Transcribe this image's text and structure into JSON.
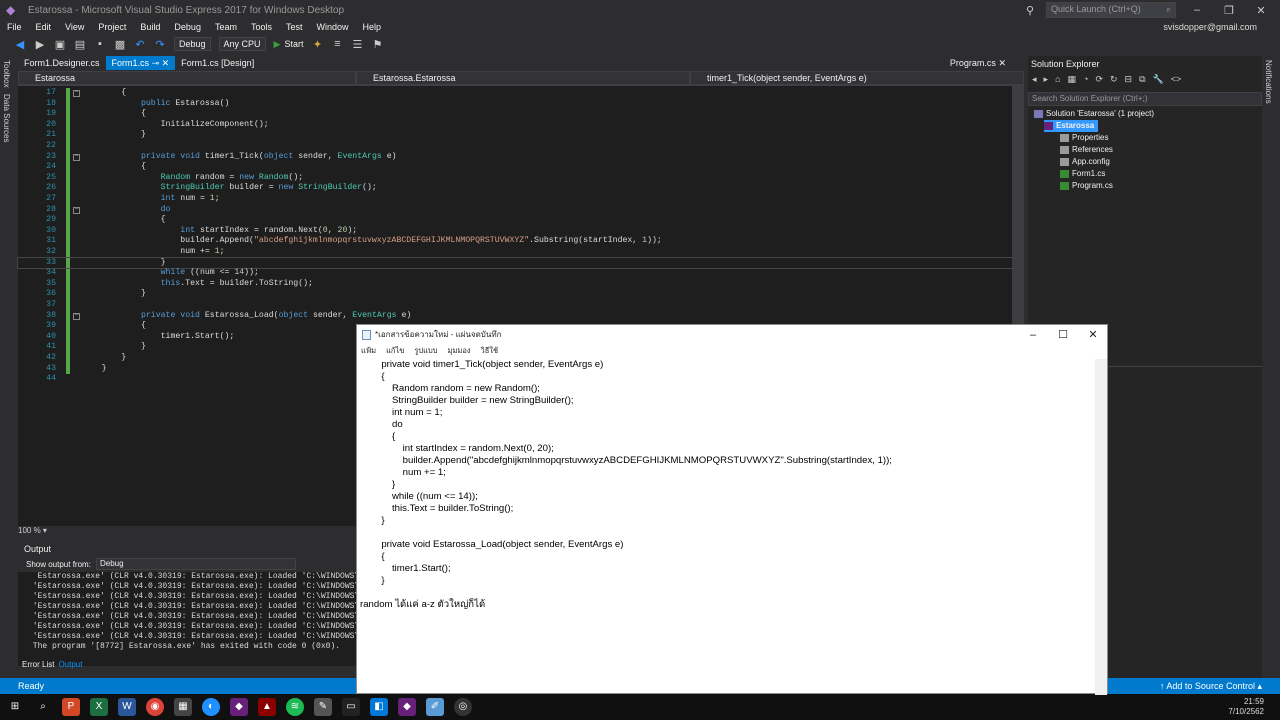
{
  "window": {
    "title": "Estarossa - Microsoft Visual Studio Express 2017 for Windows Desktop",
    "quick_launch": "Quick Launch (Ctrl+Q)",
    "user": "svisdopper@gmail.com"
  },
  "menu": [
    "File",
    "Edit",
    "View",
    "Project",
    "Build",
    "Debug",
    "Team",
    "Tools",
    "Test",
    "Window",
    "Help"
  ],
  "toolbar": {
    "config": "Debug",
    "platform": "Any CPU",
    "start": "Start"
  },
  "side_tabs": [
    "Toolbox",
    "Data Sources"
  ],
  "right_side_tab": "Notifications",
  "doc_tabs": [
    {
      "label": "Form1.Designer.cs"
    },
    {
      "label": "Form1.cs"
    },
    {
      "label": "Form1.cs [Design]"
    }
  ],
  "doc_tab_right": "Program.cs",
  "navbar": {
    "project": "Estarossa",
    "class": "Estarossa.Estarossa",
    "member": "timer1_Tick(object sender, EventArgs e)"
  },
  "zoom": "100 %",
  "code_lines": [
    {
      "n": "17",
      "t": "        {"
    },
    {
      "n": "18",
      "t": "            public Estarossa()"
    },
    {
      "n": "19",
      "t": "            {"
    },
    {
      "n": "20",
      "t": "                InitializeComponent();"
    },
    {
      "n": "21",
      "t": "            }"
    },
    {
      "n": "22",
      "t": ""
    },
    {
      "n": "23",
      "t": "            private void timer1_Tick(object sender, EventArgs e)"
    },
    {
      "n": "24",
      "t": "            {"
    },
    {
      "n": "25",
      "t": "                Random random = new Random();"
    },
    {
      "n": "26",
      "t": "                StringBuilder builder = new StringBuilder();"
    },
    {
      "n": "27",
      "t": "                int num = 1;"
    },
    {
      "n": "28",
      "t": "                do"
    },
    {
      "n": "29",
      "t": "                {"
    },
    {
      "n": "30",
      "t": "                    int startIndex = random.Next(0, 20);"
    },
    {
      "n": "31",
      "t": "                    builder.Append(\"abcdefghijkmlnmopqrstuvwxyzABCDEFGHIJKMLNMOPQRSTUVWXYZ\".Substring(startIndex, 1));"
    },
    {
      "n": "32",
      "t": "                    num += 1;"
    },
    {
      "n": "33",
      "t": "                }"
    },
    {
      "n": "34",
      "t": "                while ((num <= 14));"
    },
    {
      "n": "35",
      "t": "                this.Text = builder.ToString();"
    },
    {
      "n": "36",
      "t": "            }"
    },
    {
      "n": "37",
      "t": ""
    },
    {
      "n": "38",
      "t": "            private void Estarossa_Load(object sender, EventArgs e)"
    },
    {
      "n": "39",
      "t": "            {"
    },
    {
      "n": "40",
      "t": "                timer1.Start();"
    },
    {
      "n": "41",
      "t": "            }"
    },
    {
      "n": "42",
      "t": "        }"
    },
    {
      "n": "43",
      "t": "    }"
    },
    {
      "n": "44",
      "t": ""
    }
  ],
  "output": {
    "title": "Output",
    "show_from_label": "Show output from:",
    "show_from_value": "Debug",
    "lines": [
      "  Estarossa.exe' (CLR v4.0.30319: Estarossa.exe): Loaded 'C:\\WINDOWS\\Mi",
      " 'Estarossa.exe' (CLR v4.0.30319: Estarossa.exe): Loaded 'C:\\WINDOWS\\Mi",
      " 'Estarossa.exe' (CLR v4.0.30319: Estarossa.exe): Loaded 'C:\\WINDOWS\\Mi",
      " 'Estarossa.exe' (CLR v4.0.30319: Estarossa.exe): Loaded 'C:\\WINDOWS\\Mi",
      " 'Estarossa.exe' (CLR v4.0.30319: Estarossa.exe): Loaded 'C:\\WINDOWS\\Mi",
      " 'Estarossa.exe' (CLR v4.0.30319: Estarossa.exe): Loaded 'C:\\WINDOWS\\Mi",
      " 'Estarossa.exe' (CLR v4.0.30319: Estarossa.exe): Loaded 'C:\\WINDOWS\\Mi",
      " The program '[8772] Estarossa.exe' has exited with code 0 (0x0)."
    ],
    "tabs": [
      "Error List",
      "Output"
    ]
  },
  "solution": {
    "title": "Solution Explorer",
    "search": "Search Solution Explorer (Ctrl+;)",
    "items": [
      {
        "label": "Solution 'Estarossa' (1 project)",
        "level": 0
      },
      {
        "label": "Estarossa",
        "level": 1
      },
      {
        "label": "Properties",
        "level": 2
      },
      {
        "label": "References",
        "level": 2
      },
      {
        "label": "App.config",
        "level": 2
      },
      {
        "label": "Form1.cs",
        "level": 2
      },
      {
        "label": "Program.cs",
        "level": 2
      }
    ]
  },
  "status": {
    "left": "Ready",
    "right": "Add to Source Control"
  },
  "clock": {
    "time": "21:59",
    "date": "7/10/2562"
  },
  "notepad": {
    "title": "*เอกสารข้อความใหม่ - แผ่นจดบันทึก",
    "menu": [
      "แฟ้ม",
      "แก้ไข",
      "รูปแบบ",
      "มุมมอง",
      "วิธีใช้"
    ],
    "lines": [
      "        private void timer1_Tick(object sender, EventArgs e)",
      "        {",
      "            Random random = new Random();",
      "            StringBuilder builder = new StringBuilder();",
      "            int num = 1;",
      "            do",
      "            {",
      "                int startIndex = random.Next(0, 20);",
      "                builder.Append(\"abcdefghijkmlnmopqrstuvwxyzABCDEFGHIJKMLNMOPQRSTUVWXYZ\".Substring(startIndex, 1));",
      "                num += 1;",
      "            }",
      "            while ((num <= 14));",
      "            this.Text = builder.ToString();",
      "        }",
      "",
      "        private void Estarossa_Load(object sender, EventArgs e)",
      "        {",
      "            timer1.Start();",
      "        }",
      "",
      "random ได้แค่ a-z ตัวใหญ่ก็ได้"
    ]
  }
}
